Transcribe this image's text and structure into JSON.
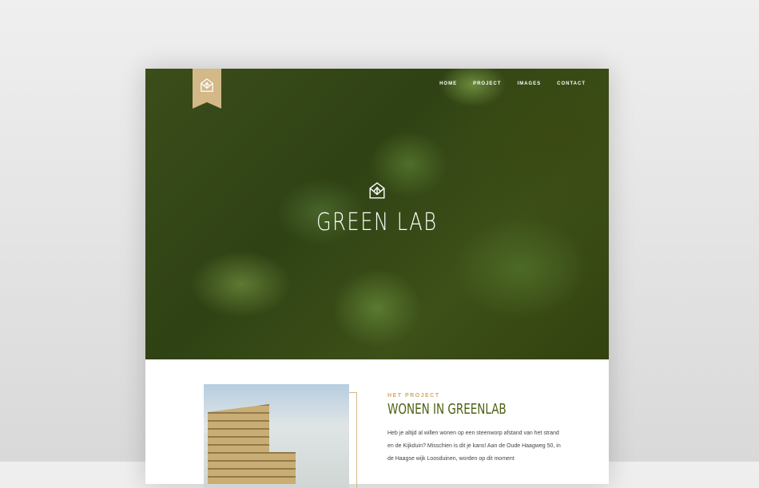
{
  "nav": {
    "items": [
      "HOME",
      "PROJECT",
      "IMAGES",
      "CONTACT"
    ]
  },
  "hero": {
    "title": "GREEN LAB"
  },
  "project": {
    "kicker": "HET PROJECT",
    "title": "WONEN IN GREENLAB",
    "body": "Heb je altijd al willen wonen op een steenworp afstand van het strand en de Kijkduin? Misschien is dit je kans! Aan de Oude Haagweg 50, in de Haagse wijk Loosduinen, worden op dit moment"
  },
  "colors": {
    "accent": "#d3b888",
    "heading": "#4c6212"
  }
}
